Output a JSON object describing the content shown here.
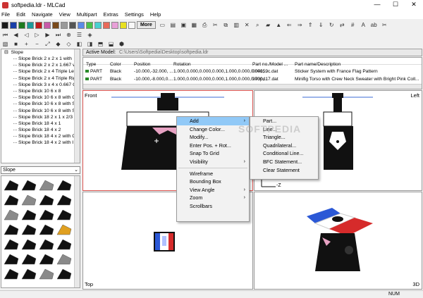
{
  "window": {
    "title": "softpedia.ldr - MLCad",
    "minimize": "—",
    "maximize": "☐",
    "close": "✕"
  },
  "menu": [
    "File",
    "Edit",
    "Navigate",
    "View",
    "Multipart",
    "Extras",
    "Settings",
    "Help"
  ],
  "toolbar": {
    "more_label": "More"
  },
  "colors": [
    "#1a1a1a",
    "#1a3fa8",
    "#1e7a1e",
    "#1b9a9a",
    "#c01b1b",
    "#c85aa8",
    "#7a4a1b",
    "#9a9a9a",
    "#555555",
    "#5a8ae8",
    "#4ac04a",
    "#4ad0d0",
    "#e86a5a",
    "#e8a0d8",
    "#e8e020",
    "#f8f8f8"
  ],
  "tree": {
    "root": "Slope",
    "items": [
      "Slope Brick  2 x  2 x  1 with",
      "Slope Brick  2 x  2 x  1.667 w",
      "Slope Brick  2 x  4 Triple Lef",
      "Slope Brick  2 x  4 Triple Rig",
      "Slope Brick  3 x  4 x 0.667 C",
      "Slope Brick 10  6 x  8",
      "Slope Brick 10  6 x  8 with G",
      "Slope Brick 10  6 x  8 with S",
      "Slope Brick 10  6 x  8 with S",
      "Slope Brick 18  2 x  1 x  2/3",
      "Slope Brick 18  4 x  1",
      "Slope Brick 18  4 x  2",
      "Slope Brick 18  4 x  2 with C",
      "Slope Brick 18  4 x  2 with I"
    ]
  },
  "category_select": "Slope",
  "model": {
    "label": "Active Model:",
    "path": "C:\\Users\\Softpedia\\Desktop\\softpedia.ldr",
    "headers": [
      "Type",
      "Color",
      "Position",
      "Rotation",
      "Part no./Model ...",
      "Part name/Description"
    ],
    "rows": [
      {
        "type": "PART",
        "color": "Black",
        "position": "-10.000,-32.000, ...",
        "rotation": "1.000,0.000,0.000,0.000,1.000,0.000,0.000,...",
        "part": "004159c.dat",
        "desc": "Sticker System with France Flag Pattern"
      },
      {
        "type": "PART",
        "color": "Black",
        "position": "-10.000,-8.000,0....",
        "rotation": "1.000,0.000,0.000,0.000,1.000,0.000,0.000,...",
        "part": "973pd17.dat",
        "desc": "Minifig Torso with Crew Neck Sweater with Bright Pink Coll..."
      }
    ]
  },
  "views": {
    "front": "Front",
    "left": "Left",
    "top": "Top",
    "three_d": "3D",
    "axis": "-Z"
  },
  "context_menu": {
    "items": [
      {
        "label": "Add",
        "submenu": true,
        "highlight": true
      },
      {
        "label": "Change Color..."
      },
      {
        "label": "Modify..."
      },
      {
        "label": "Enter Pos. + Rot..."
      },
      {
        "label": "Snap To Grid"
      },
      {
        "label": "Visibility",
        "submenu": true
      },
      {
        "sep": true
      },
      {
        "label": "Wireframe"
      },
      {
        "label": "Bounding Box"
      },
      {
        "label": "View Angle",
        "submenu": true
      },
      {
        "label": "Zoom",
        "submenu": true
      },
      {
        "label": "Scrollbars"
      }
    ],
    "add_submenu": [
      "Part...",
      "Line...",
      "Triangle...",
      "Quadrilateral...",
      "Conditional Line...",
      "BFC Statement...",
      "Clear Statement"
    ]
  },
  "status": {
    "num": "NUM"
  },
  "watermark": "SOFTPEDIA"
}
